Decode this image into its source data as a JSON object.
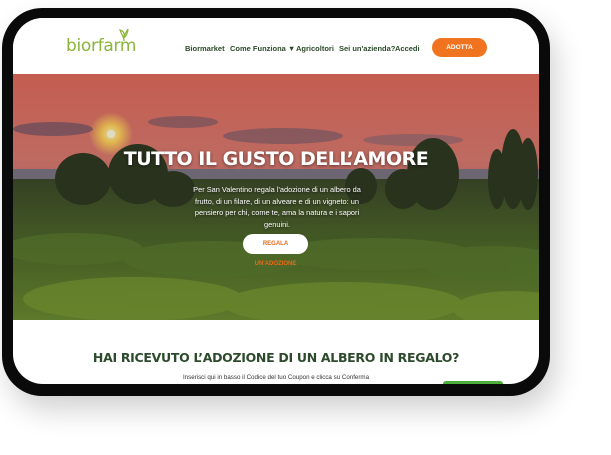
{
  "brand": {
    "logo_text": "biorfarm",
    "accent": "#f07320",
    "green": "#8bb43a"
  },
  "nav": {
    "items": [
      {
        "label": "Biormarket"
      },
      {
        "label": "Come Funziona ▼"
      },
      {
        "label": "Agricoltori"
      },
      {
        "label": "Sei un'azienda?"
      },
      {
        "label": "Accedi"
      }
    ],
    "cta_label": "ADOTTA"
  },
  "hero": {
    "title": "TUTTO IL GUSTO DELL’AMORE",
    "text": "Per San Valentino regala l'adozione di un albero da frutto, di un filare, di un alveare e di un vigneto: un pensiero per chi, come te, ama la natura e i sapori genuini.",
    "button_label": "REGALA UN'ADOZIONE"
  },
  "gift_section": {
    "title": "HAI RICEVUTO L’ADOZIONE DI UN ALBERO IN REGALO?",
    "subtitle": "Inserisci qui in basso il Codice del tuo Coupon e clicca su Conferma"
  }
}
